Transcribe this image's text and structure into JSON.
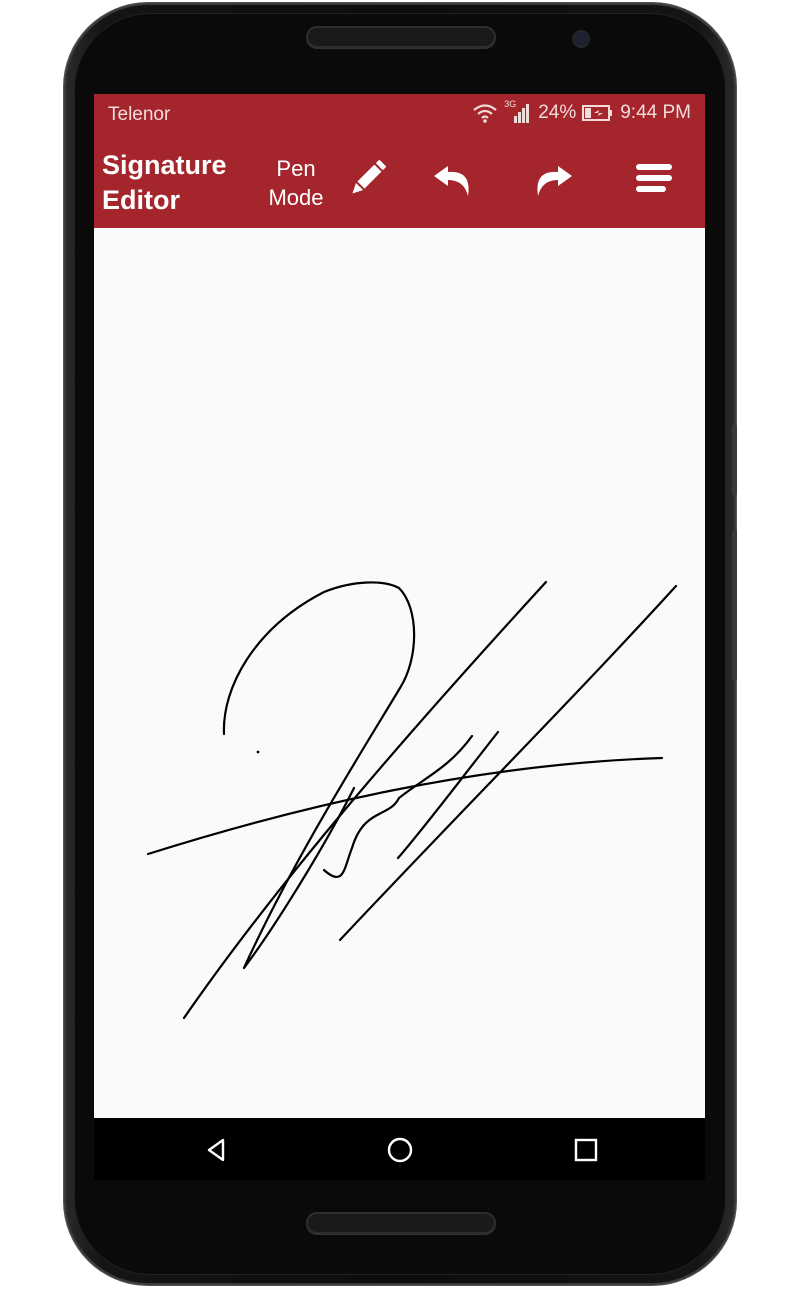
{
  "status_bar": {
    "carrier": "Telenor",
    "network_type": "3G",
    "battery": "24%",
    "time": "9:44 PM"
  },
  "toolbar": {
    "title": "Signature Editor",
    "mode_line1": "Pen",
    "mode_line2": "Mode",
    "icons": [
      "pencil-icon",
      "undo-icon",
      "redo-icon",
      "menu-icon"
    ]
  },
  "nav_bar": {
    "icons": [
      "back-icon",
      "home-icon",
      "recents-icon"
    ]
  },
  "colors": {
    "primary": "#a4262c",
    "canvas": "#fafafa",
    "stroke": "#000000"
  }
}
